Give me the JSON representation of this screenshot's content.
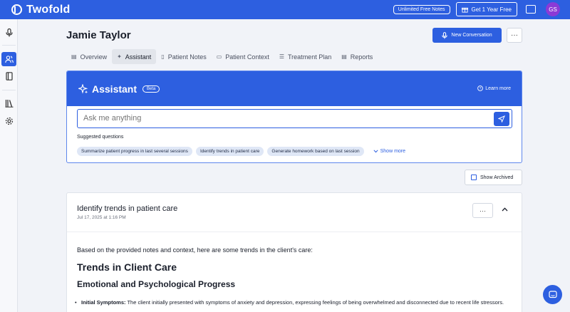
{
  "app": {
    "name": "Twofold",
    "brand_color": "#2d5fe0"
  },
  "topbar": {
    "unlimited_label": "Unlimited Free Notes",
    "year_free_label": "Get 1 Year Free",
    "avatar_initials": "GS"
  },
  "sidebar": {
    "items": [
      {
        "icon": "microphone-icon",
        "active": false
      },
      {
        "icon": "users-icon",
        "active": true
      },
      {
        "icon": "notebook-icon",
        "active": false
      },
      {
        "icon": "library-icon",
        "active": false
      },
      {
        "icon": "gear-icon",
        "active": false
      }
    ]
  },
  "patient": {
    "name": "Jamie Taylor"
  },
  "header": {
    "new_conversation_label": "New Conversation",
    "more_label": "···"
  },
  "tabs": [
    {
      "label": "Overview",
      "icon": "overview-icon",
      "active": false
    },
    {
      "label": "Assistant",
      "icon": "sparkle-icon",
      "active": true
    },
    {
      "label": "Patient Notes",
      "icon": "notes-icon",
      "active": false
    },
    {
      "label": "Patient Context",
      "icon": "document-icon",
      "active": false
    },
    {
      "label": "Treatment Plan",
      "icon": "list-icon",
      "active": false
    },
    {
      "label": "Reports",
      "icon": "report-icon",
      "active": false
    }
  ],
  "assistant": {
    "title": "Assistant",
    "badge": "Beta",
    "learn_more": "Learn more",
    "input_placeholder": "Ask me anything",
    "suggested_label": "Suggested questions",
    "suggestions": [
      "Summarize patient progress in last several sessions",
      "Identify trends in patient care",
      "Generate homework based on last session"
    ],
    "show_more": "Show more"
  },
  "archived": {
    "label": "Show Archived",
    "checked": false
  },
  "response": {
    "title": "Identify trends in patient care",
    "date": "Jul 17, 2025 at 1:16 PM",
    "more_label": "···",
    "intro": "Based on the provided notes and context, here are some trends in the client's care:",
    "heading1": "Trends in Client Care",
    "heading2": "Emotional and Psychological Progress",
    "bullet_label": "Initial Symptoms:",
    "bullet_text": "The client initially presented with symptoms of anxiety and depression, expressing feelings of being overwhelmed and disconnected due to recent life stressors."
  }
}
